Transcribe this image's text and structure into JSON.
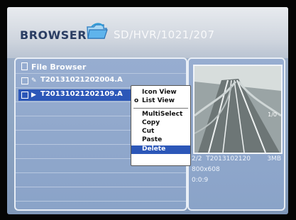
{
  "header": {
    "title": "BROWSER",
    "path": "SD/HVR/1021/207"
  },
  "file_browser": {
    "title": "File Browser",
    "files": [
      {
        "name": "T20131021202004.A"
      },
      {
        "name": "T20131021202109.A"
      }
    ]
  },
  "context_menu": {
    "items": [
      "Icon View",
      "List View",
      "MultiSelect",
      "Copy",
      "Cut",
      "Paste",
      "Delete"
    ],
    "selected": "List View",
    "highlighted": "Delete"
  },
  "preview": {
    "overlay_text": "1/0",
    "index": "2/2",
    "filename": "T2013102120",
    "size": "3MB",
    "resolution": "800x608",
    "duration": "0:0:9"
  },
  "colors": {
    "highlight": "#2c57b8",
    "panel": "#8fa7cc",
    "title": "#2a3d63"
  }
}
